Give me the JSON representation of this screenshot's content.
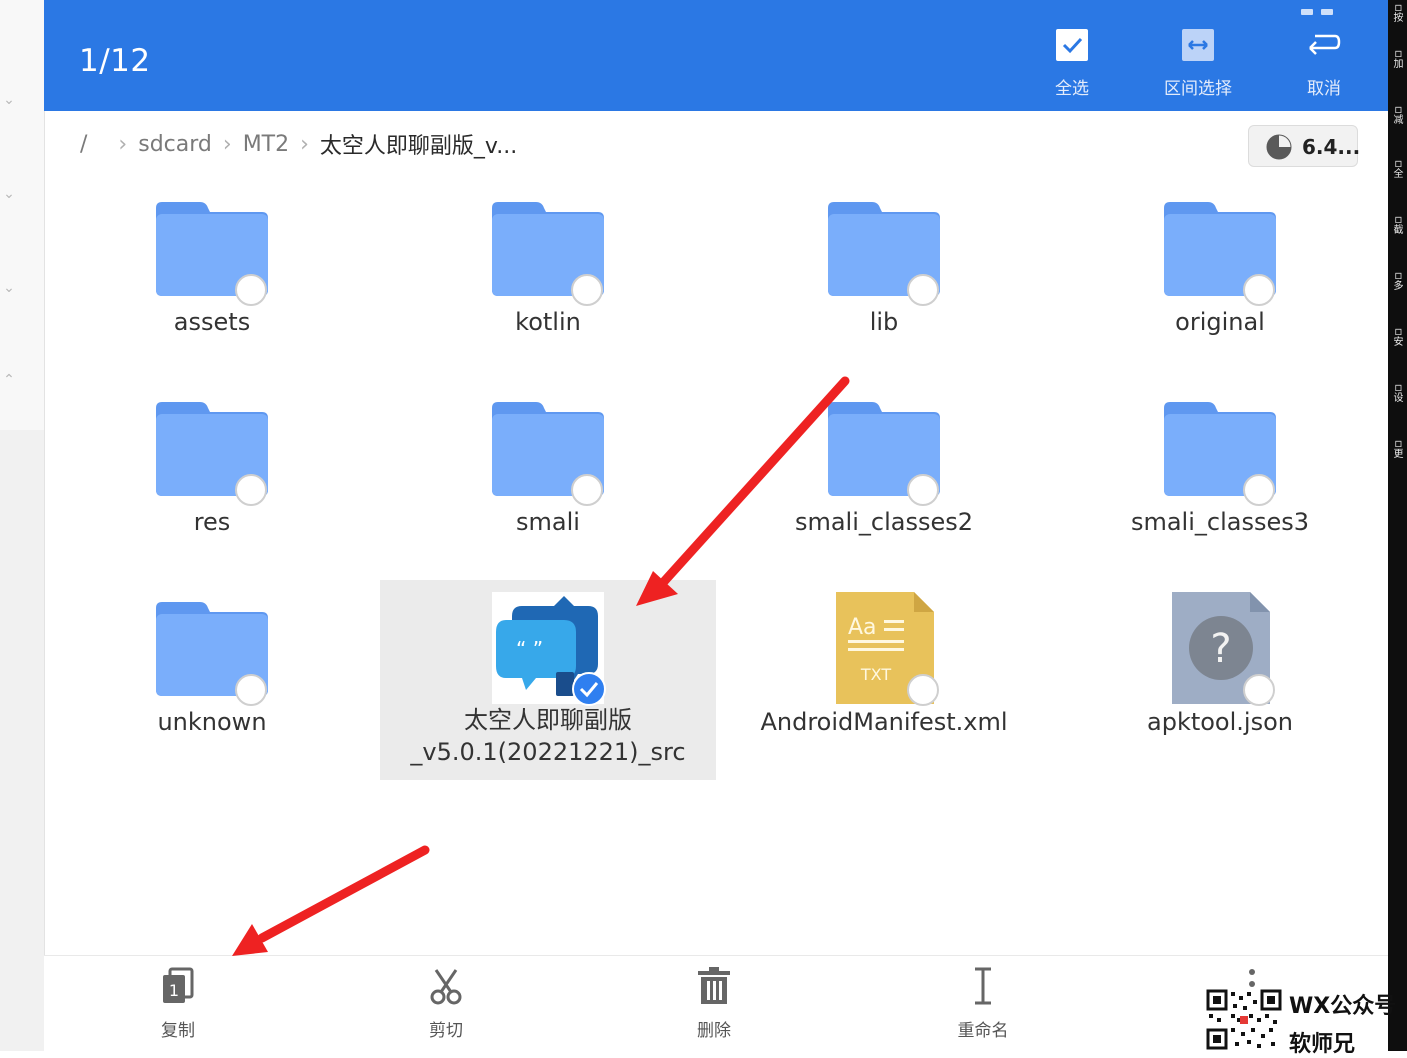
{
  "header": {
    "selection_count": "1/12",
    "actions": [
      {
        "id": "select-all",
        "label": "全选",
        "icon": "checkbox-icon"
      },
      {
        "id": "range-select",
        "label": "区间选择",
        "icon": "range-icon"
      },
      {
        "id": "cancel",
        "label": "取消",
        "icon": "undo-icon"
      }
    ]
  },
  "breadcrumb": {
    "root": "/",
    "items": [
      "sdcard",
      "MT2"
    ],
    "current": "太空人即聊副版_v..."
  },
  "storage": {
    "label": "6.4..."
  },
  "files": [
    {
      "name": "assets",
      "type": "folder",
      "selected": false
    },
    {
      "name": "kotlin",
      "type": "folder",
      "selected": false
    },
    {
      "name": "lib",
      "type": "folder",
      "selected": false
    },
    {
      "name": "original",
      "type": "folder",
      "selected": false
    },
    {
      "name": "res",
      "type": "folder",
      "selected": false
    },
    {
      "name": "smali",
      "type": "folder",
      "selected": false
    },
    {
      "name": "smali_classes2",
      "type": "folder",
      "selected": false
    },
    {
      "name": "smali_classes3",
      "type": "folder",
      "selected": false
    },
    {
      "name": "unknown",
      "type": "folder",
      "selected": false
    },
    {
      "name": "太空人即聊副版\n_v5.0.1(20221221)_src",
      "type": "apk-project",
      "selected": true
    },
    {
      "name": "AndroidManifest.xml",
      "type": "txt",
      "icon_text": "Aa\nTXT",
      "selected": false
    },
    {
      "name": "apktool.json",
      "type": "unknown",
      "icon_text": "?",
      "selected": false
    }
  ],
  "toolbar": [
    {
      "id": "copy",
      "label": "复制",
      "icon": "copy-icon",
      "badge": "1"
    },
    {
      "id": "cut",
      "label": "剪切",
      "icon": "scissors-icon"
    },
    {
      "id": "delete",
      "label": "删除",
      "icon": "trash-icon"
    },
    {
      "id": "rename",
      "label": "重命名",
      "icon": "text-cursor-icon"
    },
    {
      "id": "more",
      "label": "",
      "icon": "more-icon"
    }
  ],
  "side_dock": [
    "按",
    "加",
    "减",
    "全",
    "截",
    "多",
    "安",
    "设",
    "更"
  ],
  "watermark": {
    "line1": "WX公众号",
    "line2": "软师兄"
  },
  "colors": {
    "primary": "#2b78e4",
    "folder": "#7aaefb",
    "folder_tab": "#5f98f0",
    "selected_bg": "#ebebeb",
    "arrow": "#ee2222",
    "check": "#2f7ff0"
  }
}
